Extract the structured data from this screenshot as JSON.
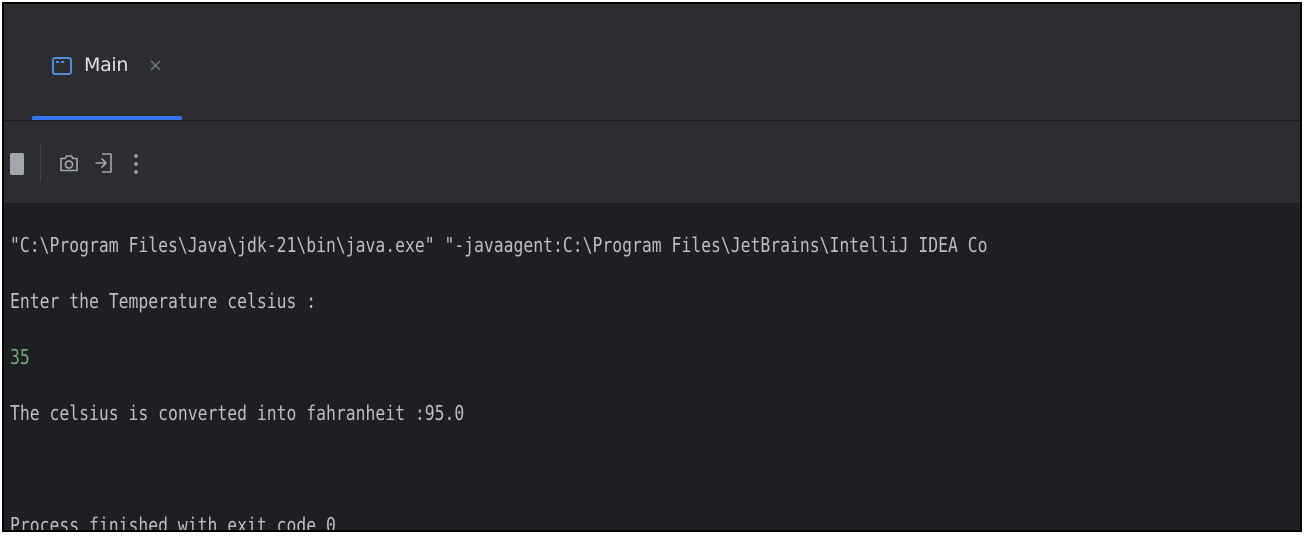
{
  "tabs": [
    {
      "label": "Main",
      "close_glyph": "×",
      "icon": "run-console-icon",
      "active": true
    }
  ],
  "toolbar": {
    "stop_icon": "stop-icon",
    "camera_icon": "camera-icon",
    "exit_icon": "exit-icon",
    "more_glyph": "⋮"
  },
  "console": {
    "lines": [
      "\"C:\\Program Files\\Java\\jdk-21\\bin\\java.exe\" \"-javaagent:C:\\Program Files\\JetBrains\\IntelliJ IDEA Co",
      "Enter the Temperature celsius :",
      "35",
      "The celsius is converted into fahranheit :95.0",
      "",
      "Process finished with exit code 0"
    ]
  },
  "colors": {
    "console_background": "#1e1f22",
    "panel_background": "#2b2d30",
    "accent": "#3574f0",
    "user_input": "#6aab73",
    "text": "#bcbec4"
  }
}
